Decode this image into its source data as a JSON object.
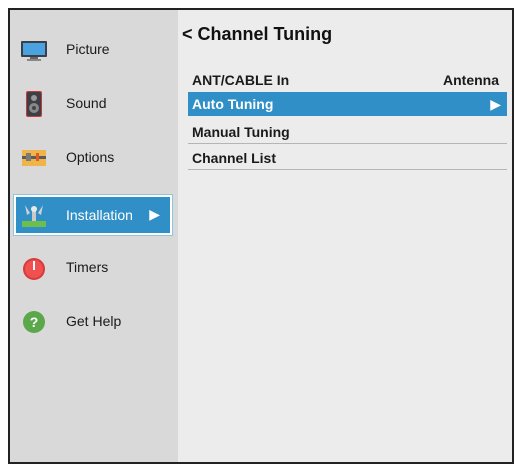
{
  "sidebar": {
    "items": [
      {
        "label": "Picture",
        "icon": "tv-monitor-icon"
      },
      {
        "label": "Sound",
        "icon": "speaker-icon"
      },
      {
        "label": "Options",
        "icon": "options-panel-icon"
      },
      {
        "label": "Installation",
        "icon": "satellite-antenna-icon",
        "selected": true
      },
      {
        "label": "Timers",
        "icon": "timer-icon"
      },
      {
        "label": "Get Help",
        "icon": "help-icon"
      }
    ],
    "selected_arrow": "▶"
  },
  "main": {
    "back_symbol": "<",
    "title": "Channel Tuning",
    "rows": [
      {
        "label": "ANT/CABLE In",
        "value": "Antenna"
      },
      {
        "label": "Auto Tuning",
        "arrow": "▶",
        "highlighted": true
      },
      {
        "label": "Manual Tuning"
      },
      {
        "label": "Channel List"
      }
    ]
  },
  "colors": {
    "highlight": "#2f8fc6",
    "sidebar_bg": "#d9d9d9",
    "main_bg": "#ececec"
  }
}
